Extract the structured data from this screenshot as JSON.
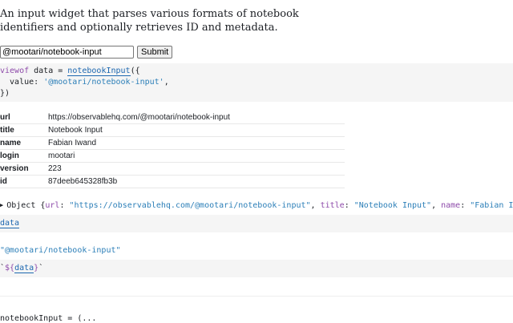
{
  "intro": {
    "description": "An input widget that parses various formats of notebook identifiers and optionally retrieves ID and metadata."
  },
  "form": {
    "input_value": "@mootari/notebook-input",
    "submit_label": "Submit"
  },
  "cell1": {
    "line1_kw": "viewof",
    "line1_var": " data = ",
    "line1_fn": "notebookInput",
    "line1_end": "({",
    "line2_key": "  value: ",
    "line2_str": "'@mootari/notebook-input'",
    "line2_end": ",",
    "line3": "})"
  },
  "metadata": {
    "rows": [
      {
        "key": "url",
        "value": "https://observablehq.com/@mootari/notebook-input"
      },
      {
        "key": "title",
        "value": "Notebook Input"
      },
      {
        "key": "name",
        "value": "Fabian Iwand"
      },
      {
        "key": "login",
        "value": "mootari"
      },
      {
        "key": "version",
        "value": "223"
      },
      {
        "key": "id",
        "value": "87deeb645328fb3b"
      }
    ]
  },
  "inspector": {
    "prefix": "Object {",
    "k1": "url",
    "v1": "\"https://observablehq.com/@mootari/notebook-input\"",
    "k2": "title",
    "v2": "\"Notebook Input\"",
    "k3": "name",
    "v3": "\"Fabian Iwand\"",
    "tail": ","
  },
  "cell2": {
    "code": "data"
  },
  "output": {
    "value": "\"@mootari/notebook-input\""
  },
  "cell3": {
    "tick_open": "`",
    "tpl_open": "${",
    "tpl_var": "data",
    "tpl_close": "}",
    "tick_close": "`"
  },
  "footer": {
    "cutoff_text": "notebookInput = (..."
  }
}
